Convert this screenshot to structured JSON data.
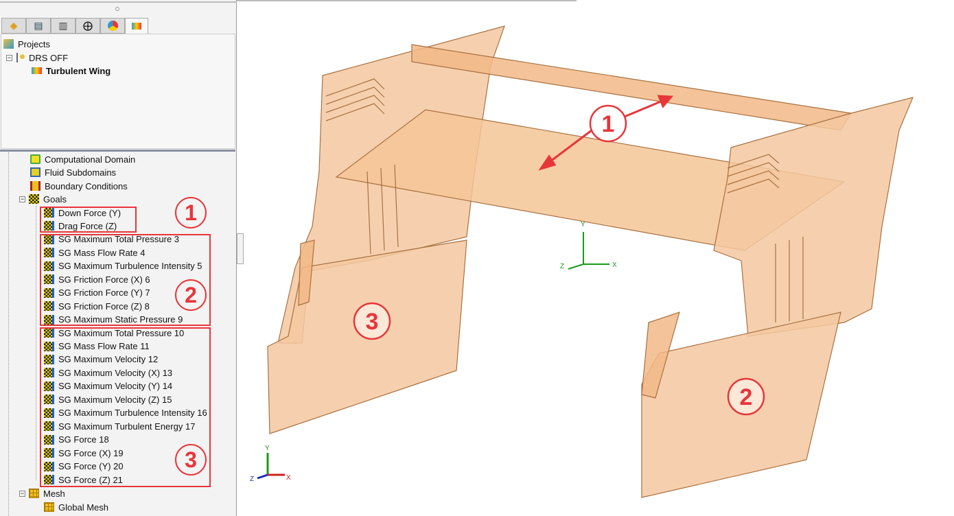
{
  "tabs": [
    "part-icon",
    "property-icon",
    "config-icon",
    "target-icon",
    "display-icon",
    "flow-simulation-icon"
  ],
  "project_tree": {
    "root": "Projects",
    "config": "DRS OFF",
    "project": "Turbulent Wing"
  },
  "analysis_tree": {
    "items": [
      "Computational Domain",
      "Fluid Subdomains",
      "Boundary Conditions"
    ],
    "goals_label": "Goals",
    "goals": [
      "Down Force (Y)",
      "Drag Force (Z)",
      "SG Maximum Total Pressure 3",
      "SG Mass Flow Rate 4",
      "SG Maximum Turbulence Intensity 5",
      "SG Friction Force (X) 6",
      "SG Friction Force (Y) 7",
      "SG Friction Force (Z) 8",
      "SG Maximum Static Pressure 9",
      "SG Maximum Total Pressure 10",
      "SG Mass Flow Rate 11",
      "SG Maximum Velocity 12",
      "SG Maximum Velocity (X) 13",
      "SG Maximum Velocity (Y) 14",
      "SG Maximum Velocity (Z) 15",
      "SG Maximum Turbulence Intensity 16",
      "SG Maximum Turbulent Energy 17",
      "SG Force 18",
      "SG Force (X) 19",
      "SG Force (Y) 20",
      "SG Force (Z) 21"
    ],
    "mesh_label": "Mesh",
    "global_mesh": "Global Mesh"
  },
  "annotations": {
    "one": "1",
    "two": "2",
    "three": "3",
    "color": "#e8353a"
  },
  "axes": {
    "x": "X",
    "y": "Y",
    "z": "Z"
  },
  "model_color": "#f5c8a0"
}
